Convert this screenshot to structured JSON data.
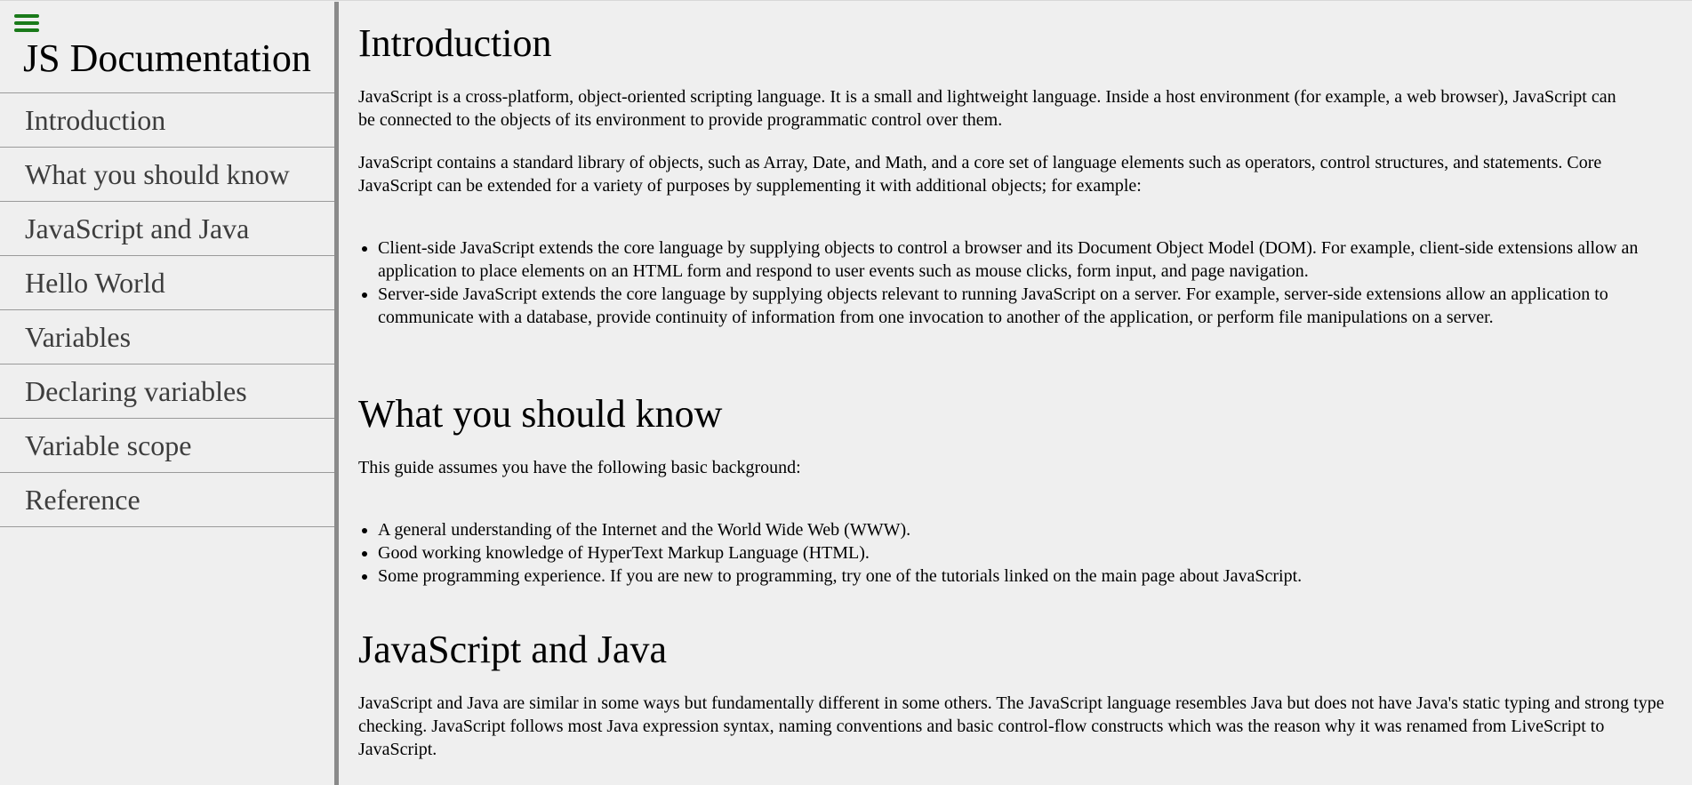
{
  "navbar": {
    "header": "JS Documentation",
    "items": [
      {
        "label": "Introduction"
      },
      {
        "label": "What you should know"
      },
      {
        "label": "JavaScript and Java"
      },
      {
        "label": "Hello World"
      },
      {
        "label": "Variables"
      },
      {
        "label": "Declaring variables"
      },
      {
        "label": "Variable scope"
      },
      {
        "label": "Reference"
      }
    ]
  },
  "sections": {
    "introduction": {
      "title": "Introduction",
      "paragraphs": [
        "JavaScript is a cross-platform, object-oriented scripting language. It is a small and lightweight language. Inside a host environment (for example, a web browser), JavaScript can be connected to the objects of its environment to provide programmatic control over them.",
        "JavaScript contains a standard library of objects, such as Array, Date, and Math, and a core set of language elements such as operators, control structures, and statements. Core JavaScript can be extended for a variety of purposes by supplementing it with additional objects; for example:"
      ],
      "list": [
        "Client-side JavaScript extends the core language by supplying objects to control a browser and its Document Object Model (DOM). For example, client-side extensions allow an application to place elements on an HTML form and respond to user events such as mouse clicks, form input, and page navigation.",
        "Server-side JavaScript extends the core language by supplying objects relevant to running JavaScript on a server. For example, server-side extensions allow an application to communicate with a database, provide continuity of information from one invocation to another of the application, or perform file manipulations on a server."
      ]
    },
    "what_you_should_know": {
      "title": "What you should know",
      "paragraphs": [
        "This guide assumes you have the following basic background:"
      ],
      "list": [
        "A general understanding of the Internet and the World Wide Web (WWW).",
        "Good working knowledge of HyperText Markup Language (HTML).",
        "Some programming experience. If you are new to programming, try one of the tutorials linked on the main page about JavaScript."
      ]
    },
    "javascript_and_java": {
      "title": "JavaScript and Java",
      "paragraphs": [
        "JavaScript and Java are similar in some ways but fundamentally different in some others. The JavaScript language resembles Java but does not have Java's static typing and strong type checking. JavaScript follows most Java expression syntax, naming conventions and basic control-flow constructs which was the reason why it was renamed from LiveScript to JavaScript."
      ]
    }
  },
  "colors": {
    "background": "#efefef",
    "menu_icon": "#1a7a1a",
    "nav_text": "#3d3d3d",
    "divider": "#9a9a9a"
  },
  "icons": {
    "menu": "hamburger-menu-icon"
  }
}
